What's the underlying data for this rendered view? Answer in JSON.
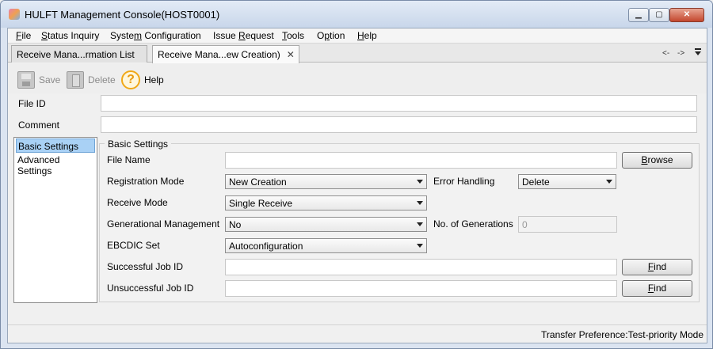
{
  "window": {
    "title": "HULFT Management Console(HOST0001)",
    "controls": {
      "minimize": "▁",
      "maximize": "▢",
      "close": "✕"
    }
  },
  "menu": [
    {
      "pre": "",
      "u": "F",
      "post": "ile"
    },
    {
      "pre": "",
      "u": "S",
      "post": "tatus Inquiry"
    },
    {
      "pre": "Syste",
      "u": "m",
      "post": " Configuration"
    },
    {
      "pre": "Issue ",
      "u": "R",
      "post": "equest"
    },
    {
      "pre": "",
      "u": "T",
      "post": "ools"
    },
    {
      "pre": "O",
      "u": "p",
      "post": "tion"
    },
    {
      "pre": "",
      "u": "H",
      "post": "elp"
    }
  ],
  "tabs": [
    {
      "label": "Receive Mana...rmation List"
    },
    {
      "label": "Receive Mana...ew Creation)"
    }
  ],
  "tab_nav": {
    "back": "<-",
    "forward": "->"
  },
  "toolbar": {
    "save": "Save",
    "delete": "Delete",
    "help": "Help",
    "help_glyph": "?"
  },
  "form": {
    "file_id_label": "File ID",
    "file_id_value": "",
    "comment_label": "Comment",
    "comment_value": ""
  },
  "sidebar": [
    {
      "label": "Basic Settings",
      "selected": true
    },
    {
      "label": "Advanced Settings",
      "selected": false
    }
  ],
  "basic": {
    "group_title": "Basic Settings",
    "file_name_label": "File Name",
    "file_name_value": "",
    "browse": {
      "u": "B",
      "post": "rowse"
    },
    "registration_mode_label": "Registration Mode",
    "registration_mode_value": "New Creation",
    "error_handling_label": "Error Handling",
    "error_handling_value": "Delete",
    "receive_mode_label": "Receive Mode",
    "receive_mode_value": "Single Receive",
    "generational_label": "Generational Management",
    "generational_value": "No",
    "generations_label": "No. of Generations",
    "generations_value": "0",
    "ebcdic_label": "EBCDIC Set",
    "ebcdic_value": "Autoconfiguration",
    "success_job_label": "Successful Job ID",
    "success_job_value": "",
    "unsuccess_job_label": "Unsuccessful Job ID",
    "unsuccess_job_value": "",
    "find": {
      "u": "F",
      "post": "ind"
    }
  },
  "status": {
    "text": "Transfer Preference:Test-priority Mode"
  }
}
